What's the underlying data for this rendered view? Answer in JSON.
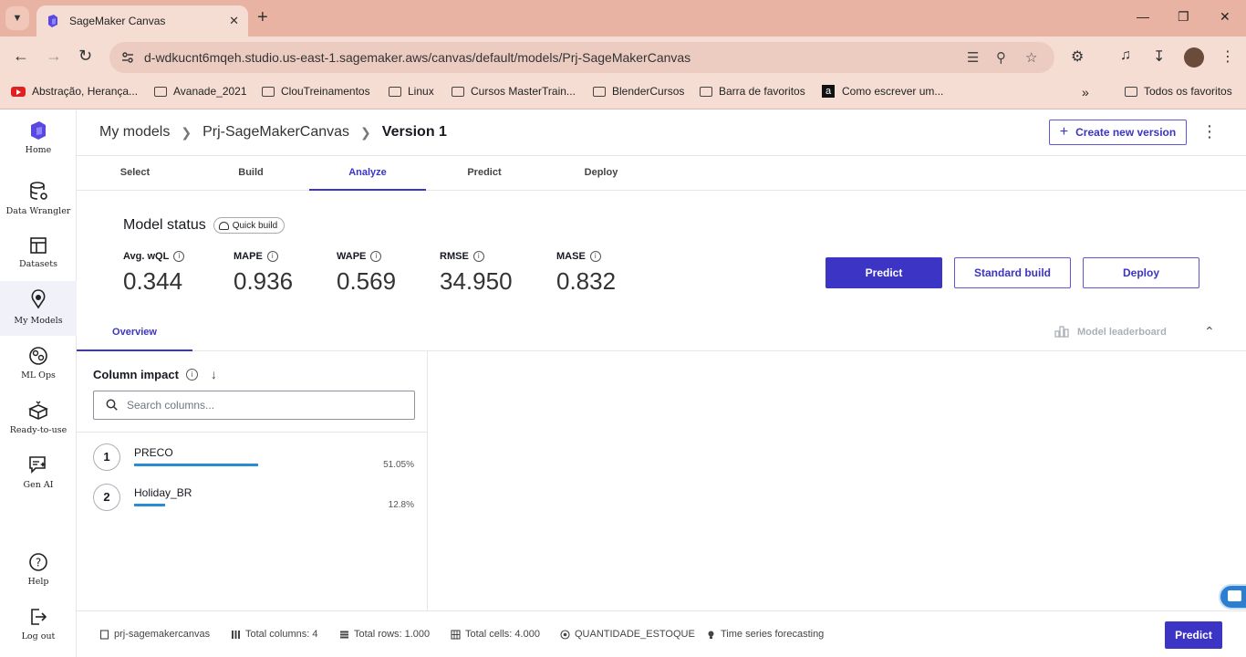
{
  "browser": {
    "tab_title": "SageMaker Canvas",
    "url": "d-wdkucnt6mqeh.studio.us-east-1.sagemaker.aws/canvas/default/models/Prj-SageMakerCanvas",
    "bookmarks": [
      {
        "label": "Abstração, Herança...",
        "icon": "youtube-icon"
      },
      {
        "label": "Avanade_2021",
        "icon": "folder-icon"
      },
      {
        "label": "ClouTreinamentos",
        "icon": "folder-icon"
      },
      {
        "label": "Linux",
        "icon": "folder-icon"
      },
      {
        "label": "Cursos MasterTrain...",
        "icon": "folder-icon"
      },
      {
        "label": "BlenderCursos",
        "icon": "folder-icon"
      },
      {
        "label": "Barra de favoritos",
        "icon": "folder-icon"
      },
      {
        "label": "Como escrever um...",
        "icon": "amazon-icon"
      }
    ],
    "all_bookmarks": "Todos os favoritos"
  },
  "sidebar": {
    "items": [
      {
        "label": "Home",
        "icon": "home-icon"
      },
      {
        "label": "Data Wrangler",
        "icon": "data-wrangler-icon"
      },
      {
        "label": "Datasets",
        "icon": "datasets-icon"
      },
      {
        "label": "My Models",
        "icon": "my-models-icon",
        "active": true
      },
      {
        "label": "ML Ops",
        "icon": "ml-ops-icon"
      },
      {
        "label": "Ready-to-use",
        "icon": "ready-to-use-icon"
      },
      {
        "label": "Gen AI",
        "icon": "gen-ai-icon"
      },
      {
        "label": "Help",
        "icon": "help-icon"
      },
      {
        "label": "Log out",
        "icon": "log-out-icon"
      }
    ]
  },
  "header": {
    "crumbs": [
      "My models",
      "Prj-SageMakerCanvas",
      "Version 1"
    ],
    "create_btn": "Create new version"
  },
  "steps": [
    "Select",
    "Build",
    "Analyze",
    "Predict",
    "Deploy"
  ],
  "status": {
    "title": "Model status",
    "badge": "Quick build",
    "metrics": [
      {
        "label": "Avg. wQL",
        "value": "0.344"
      },
      {
        "label": "MAPE",
        "value": "0.936"
      },
      {
        "label": "WAPE",
        "value": "0.569"
      },
      {
        "label": "RMSE",
        "value": "34.950"
      },
      {
        "label": "MASE",
        "value": "0.832"
      }
    ],
    "predict_btn": "Predict",
    "standard_btn": "Standard build",
    "deploy_btn": "Deploy"
  },
  "subtabs": {
    "overview": "Overview",
    "leaderboard": "Model leaderboard"
  },
  "column_impact": {
    "title": "Column impact",
    "search_placeholder": "Search columns...",
    "rows": [
      {
        "rank": "1",
        "name": "PRECO",
        "pct": "51.05%",
        "value": 0.5105
      },
      {
        "rank": "2",
        "name": "Holiday_BR",
        "pct": "12.8%",
        "value": 0.128
      }
    ]
  },
  "footer": {
    "project": "prj-sagemakercanvas",
    "columns": "Total columns: 4",
    "rows": "Total rows: 1.000",
    "cells": "Total cells: 4.000",
    "target": "QUANTIDADE_ESTOQUE",
    "type": "Time series forecasting",
    "predict_btn": "Predict"
  },
  "colors": {
    "accent": "#3c34c5",
    "bar": "#2b8cd6"
  }
}
